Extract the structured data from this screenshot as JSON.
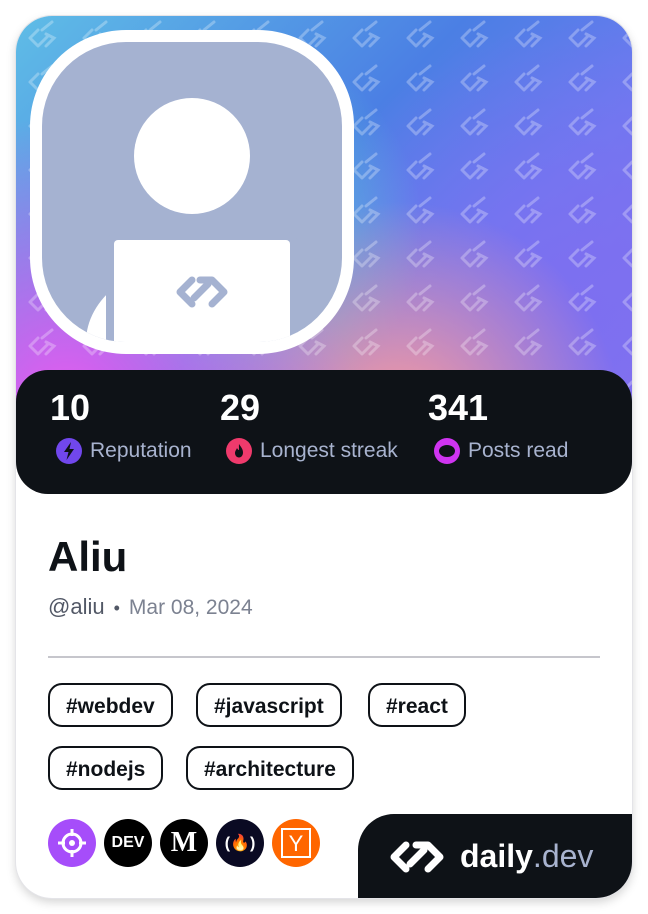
{
  "profile": {
    "name": "Aliu",
    "handle": "@aliu",
    "separator": "•",
    "joined": "Mar 08, 2024"
  },
  "stats": [
    {
      "value": "10",
      "label": "Reputation",
      "icon": "lightning-icon",
      "color": "#7147ed"
    },
    {
      "value": "29",
      "label": "Longest streak",
      "icon": "flame-icon",
      "color": "#ef3a6c"
    },
    {
      "value": "341",
      "label": "Posts read",
      "icon": "eye-icon",
      "color": "#cf34f0"
    }
  ],
  "tags": [
    "#webdev",
    "#javascript",
    "#react",
    "#nodejs",
    "#architecture"
  ],
  "sources": [
    {
      "name": "crosshair-source-icon",
      "color": "#a64dfa",
      "label": ""
    },
    {
      "name": "dev-to-source-icon",
      "color": "#000000",
      "label": "DEV"
    },
    {
      "name": "medium-source-icon",
      "color": "#000000",
      "label": "M"
    },
    {
      "name": "freecodecamp-source-icon",
      "color": "#0a0a23",
      "label": "(🔥)"
    },
    {
      "name": "hacker-news-source-icon",
      "color": "#ff6600",
      "label": "Y"
    }
  ],
  "brand": {
    "daily": "daily",
    "dev": ".dev"
  },
  "colors": {
    "card_dark": "#0e1217",
    "avatar_bg": "#a5b2d1",
    "secondary_text": "#a8b3cf"
  }
}
